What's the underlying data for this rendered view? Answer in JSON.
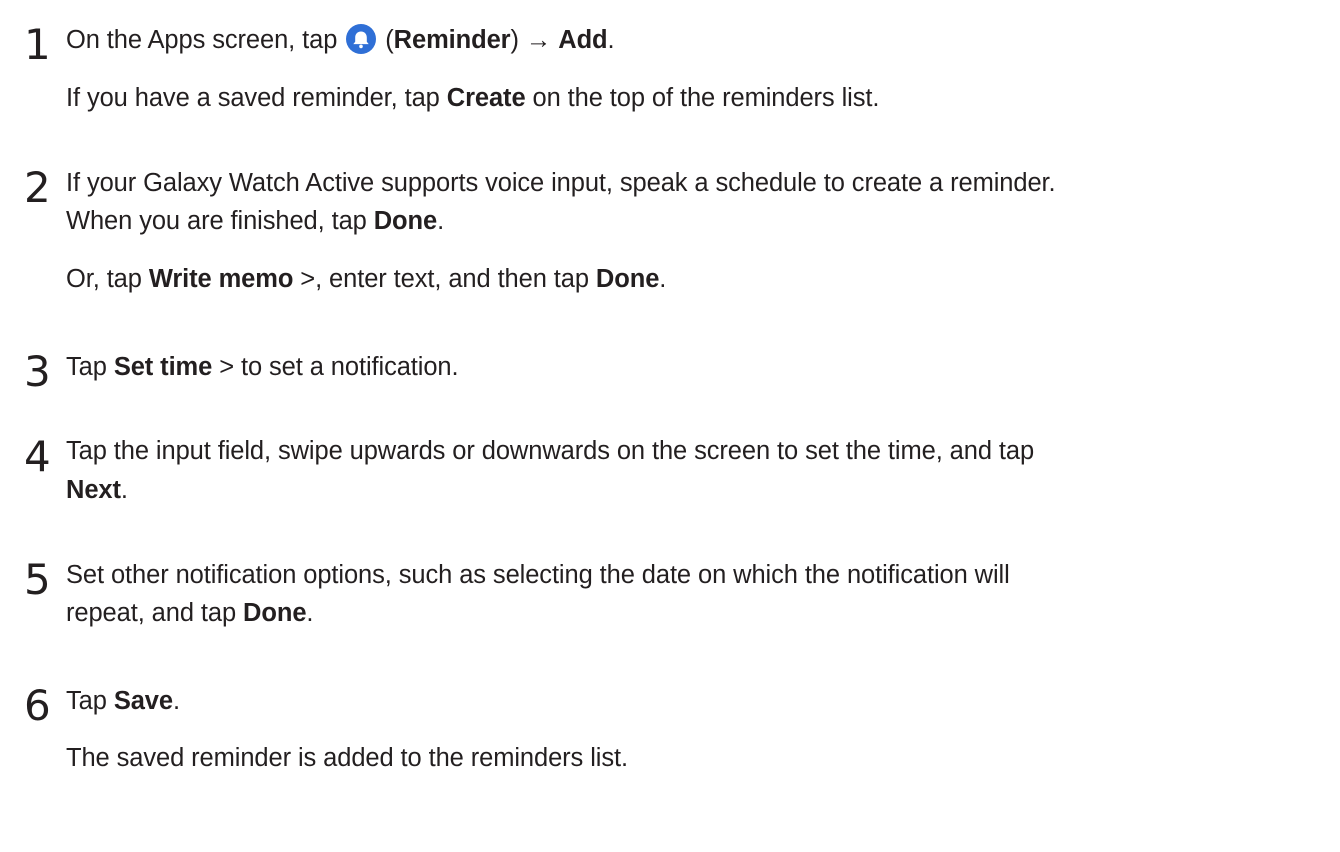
{
  "icons": {
    "reminder_icon": "bell-icon",
    "reminder_icon_color": "#2f6fd6"
  },
  "steps": [
    {
      "number": "1",
      "line1": {
        "t1": "On the Apps screen, tap ",
        "t2": " (",
        "b1": "Reminder",
        "t3": ") → ",
        "b2": "Add",
        "t4": "."
      },
      "line2": {
        "t1": "If you have a saved reminder, tap ",
        "b1": "Create",
        "t2": " on the top of the reminders list."
      }
    },
    {
      "number": "2",
      "line1": {
        "t1": "If your Galaxy Watch Active supports voice input, speak a schedule to create a reminder."
      },
      "line1b": {
        "t1": "When you are finished, tap ",
        "b1": "Done",
        "t2": "."
      },
      "line2": {
        "t1": "Or, tap ",
        "b1": "Write memo",
        "t2": " >, enter text, and then tap ",
        "b2": "Done",
        "t3": "."
      }
    },
    {
      "number": "3",
      "line1": {
        "t1": "Tap ",
        "b1": "Set time",
        "t2": " > to set a notification."
      }
    },
    {
      "number": "4",
      "line1": {
        "t1": "Tap the input field, swipe upwards or downwards on the screen to set the time, and tap"
      },
      "line1b": {
        "b1": "Next",
        "t1": "."
      }
    },
    {
      "number": "5",
      "line1": {
        "t1": "Set other notification options, such as selecting the date on which the notification will"
      },
      "line1b": {
        "t1": "repeat, and tap ",
        "b1": "Done",
        "t2": "."
      }
    },
    {
      "number": "6",
      "line1": {
        "t1": "Tap ",
        "b1": "Save",
        "t2": "."
      },
      "line2": {
        "t1": "The saved reminder is added to the reminders list."
      }
    }
  ]
}
